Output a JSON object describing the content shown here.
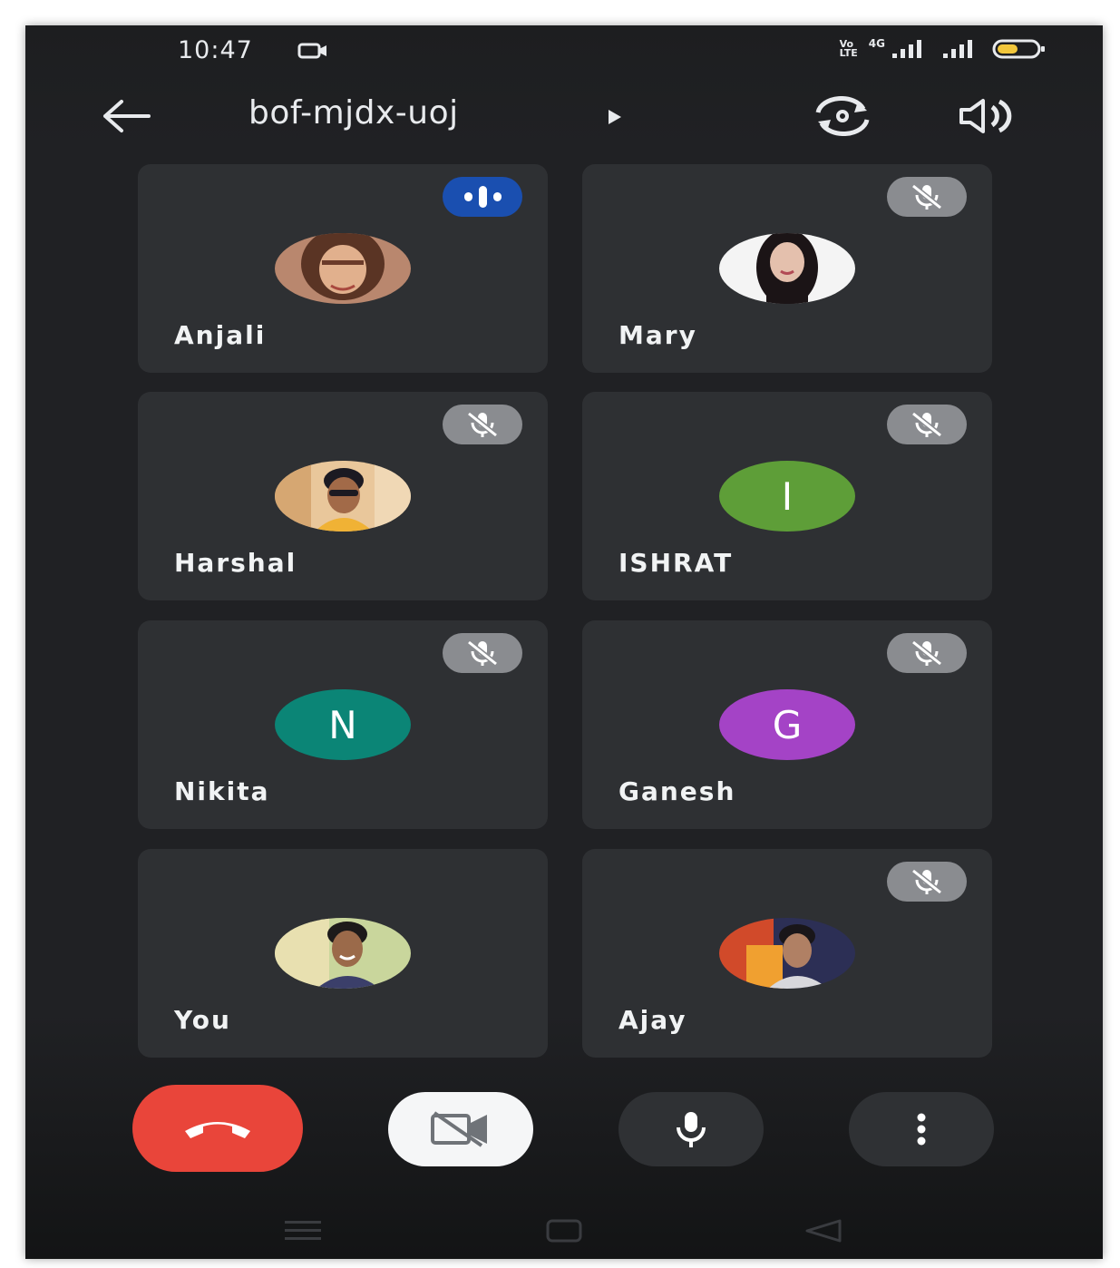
{
  "status_bar": {
    "time": "10:47",
    "volte_label": "Vo\nLTE",
    "network_label": "4G"
  },
  "header": {
    "meeting_code": "bof-mjdx-uoj"
  },
  "participants": [
    {
      "name": "Anjali",
      "avatar_type": "photo",
      "mic_state": "speaking"
    },
    {
      "name": "Mary",
      "avatar_type": "photo",
      "mic_state": "muted"
    },
    {
      "name": "Harshal",
      "avatar_type": "photo",
      "mic_state": "muted"
    },
    {
      "name": "ISHRAT",
      "avatar_type": "initial",
      "initial": "I",
      "avatar_color": "#5e9e38",
      "mic_state": "muted"
    },
    {
      "name": "Nikita",
      "avatar_type": "initial",
      "initial": "N",
      "avatar_color": "#0b8576",
      "mic_state": "muted"
    },
    {
      "name": "Ganesh",
      "avatar_type": "initial",
      "initial": "G",
      "avatar_color": "#a443c6",
      "mic_state": "muted"
    },
    {
      "name": "You",
      "avatar_type": "photo",
      "mic_state": "none"
    },
    {
      "name": "Ajay",
      "avatar_type": "photo",
      "mic_state": "muted"
    }
  ],
  "controls": {
    "end_call_color": "#e9453a",
    "camera_state": "off",
    "mic_state": "on"
  },
  "icons": [
    "back-arrow-icon",
    "play-arrow-icon",
    "switch-camera-icon",
    "speaker-icon",
    "mic-off-icon",
    "audio-level-icon",
    "end-call-icon",
    "video-off-icon",
    "mic-icon",
    "more-vert-icon",
    "menu-icon",
    "home-icon",
    "back-nav-icon"
  ]
}
